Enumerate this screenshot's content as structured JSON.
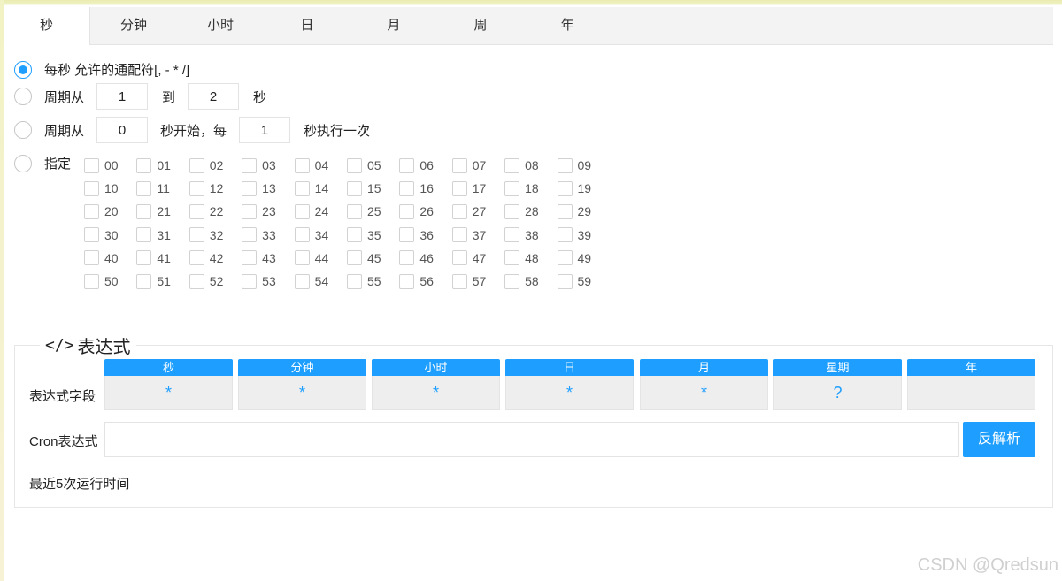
{
  "tabs": [
    {
      "label": "秒",
      "active": true
    },
    {
      "label": "分钟"
    },
    {
      "label": "小时"
    },
    {
      "label": "日"
    },
    {
      "label": "月"
    },
    {
      "label": "周"
    },
    {
      "label": "年"
    }
  ],
  "options": {
    "every": {
      "label": "每秒 允许的通配符[, - * /]"
    },
    "range": {
      "prefix": "周期从",
      "from": "1",
      "middle": "到",
      "to": "2",
      "suffix": "秒"
    },
    "loop": {
      "prefix": "周期从",
      "start": "0",
      "middle": "秒开始，每",
      "step": "1",
      "suffix": "秒执行一次"
    },
    "specific": {
      "label": "指定"
    }
  },
  "seconds": [
    [
      "00",
      "01",
      "02",
      "03",
      "04",
      "05",
      "06",
      "07",
      "08",
      "09"
    ],
    [
      "10",
      "11",
      "12",
      "13",
      "14",
      "15",
      "16",
      "17",
      "18",
      "19"
    ],
    [
      "20",
      "21",
      "22",
      "23",
      "24",
      "25",
      "26",
      "27",
      "28",
      "29"
    ],
    [
      "30",
      "31",
      "32",
      "33",
      "34",
      "35",
      "36",
      "37",
      "38",
      "39"
    ],
    [
      "40",
      "41",
      "42",
      "43",
      "44",
      "45",
      "46",
      "47",
      "48",
      "49"
    ],
    [
      "50",
      "51",
      "52",
      "53",
      "54",
      "55",
      "56",
      "57",
      "58",
      "59"
    ]
  ],
  "expression": {
    "legend_icon": "</>",
    "legend": "表达式",
    "fields_label": "表达式字段",
    "fields": [
      {
        "name": "秒",
        "value": "*"
      },
      {
        "name": "分钟",
        "value": "*"
      },
      {
        "name": "小时",
        "value": "*"
      },
      {
        "name": "日",
        "value": "*"
      },
      {
        "name": "月",
        "value": "*"
      },
      {
        "name": "星期",
        "value": "?"
      },
      {
        "name": "年",
        "value": ""
      }
    ],
    "cron_label": "Cron表达式",
    "cron_value": "",
    "parse_button": "反解析",
    "recent_label": "最近5次运行时间"
  },
  "colors": {
    "accent": "#1e9fff"
  },
  "watermark": "CSDN @Qredsun"
}
